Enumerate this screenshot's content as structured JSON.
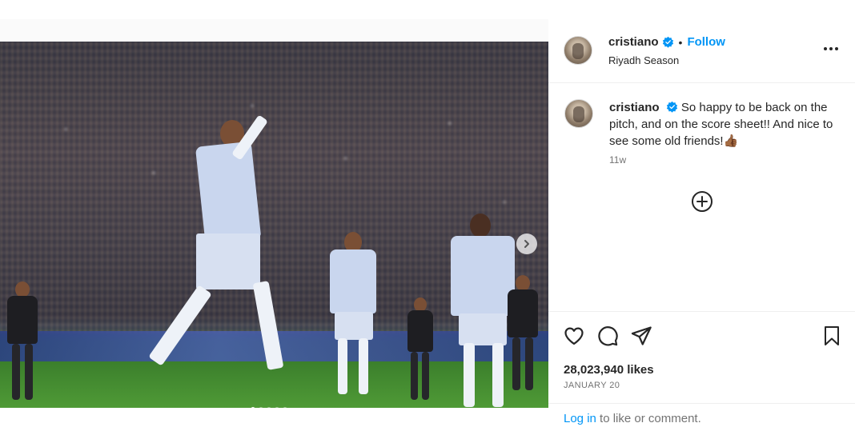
{
  "post": {
    "username": "cristiano",
    "location": "Riyadh Season",
    "follow_label": "Follow",
    "separator": "•",
    "caption_text": "So happy to be back on the pitch, and on the score sheet!! And nice to see some old friends!👍🏾",
    "time_ago": "11w",
    "likes": "28,023,940 likes",
    "date": "JANUARY 20",
    "login_link": "Log in",
    "login_rest": " to like or comment."
  },
  "carousel": {
    "slide_count": 5,
    "active_index": 0
  },
  "colors": {
    "accent": "#0095f6",
    "verified": "#0095f6",
    "text": "#262626",
    "muted": "#737373"
  },
  "icons": {
    "verified": "verified-badge-icon",
    "more": "more-options-icon",
    "add_comment": "add-comment-icon",
    "like": "heart-icon",
    "comment": "comment-icon",
    "share": "share-icon",
    "save": "bookmark-icon",
    "next": "chevron-right-icon"
  }
}
